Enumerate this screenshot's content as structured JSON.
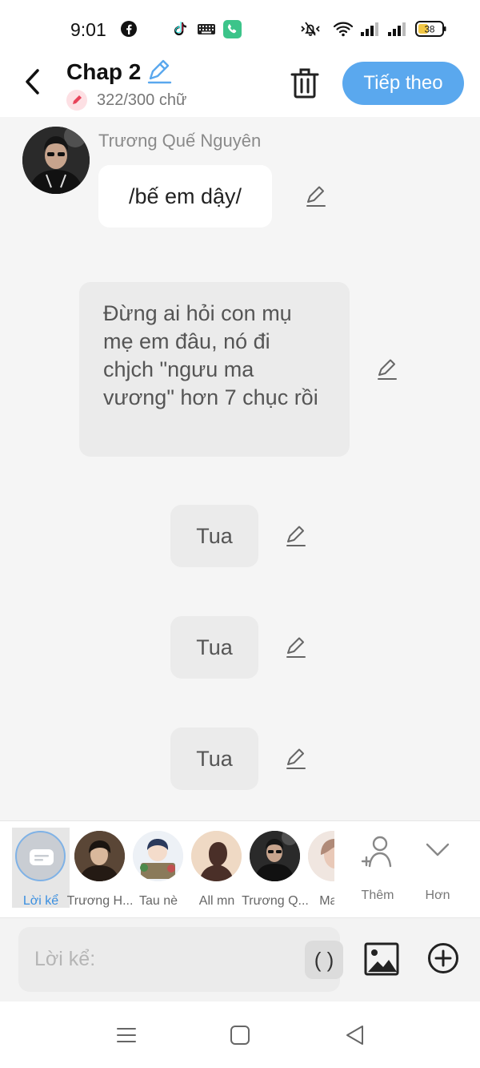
{
  "status_bar": {
    "time": "9:01",
    "battery": "38",
    "icons": [
      "facebook-icon",
      "tiktok-icon",
      "keyboard-icon",
      "phone-icon",
      "mute-icon",
      "wifi-icon",
      "signal-icon",
      "signal-icon",
      "battery-icon"
    ]
  },
  "header": {
    "title": "Chap 2",
    "word_count": "322/300 chữ",
    "next_label": "Tiếp theo"
  },
  "chat": {
    "speaker_name": "Trương Quế Nguyên",
    "messages": [
      {
        "text": "/bế em dậy/"
      },
      {
        "text": "Đừng ai hỏi con mụ mẹ em đâu, nó đi chjch \"ngưu ma vương\" hơn 7 chục rồi"
      },
      {
        "text": "Tua"
      },
      {
        "text": "Tua"
      },
      {
        "text": "Tua"
      }
    ]
  },
  "characters": {
    "items": [
      {
        "label": "Lời kể",
        "selected": true
      },
      {
        "label": "Trương H...",
        "selected": false
      },
      {
        "label": "Tau nè",
        "selected": false
      },
      {
        "label": "All mn",
        "selected": false
      },
      {
        "label": "Trương Q...",
        "selected": false
      },
      {
        "label": "Mam",
        "selected": false
      }
    ],
    "add_label": "Thêm",
    "more_label": "Hơn"
  },
  "input": {
    "placeholder": "Lời kể:",
    "paren_label": "( )"
  },
  "colors": {
    "accent": "#5aa8ee",
    "selected_label": "#3a8fe0",
    "count_icon": "#e8435a"
  }
}
